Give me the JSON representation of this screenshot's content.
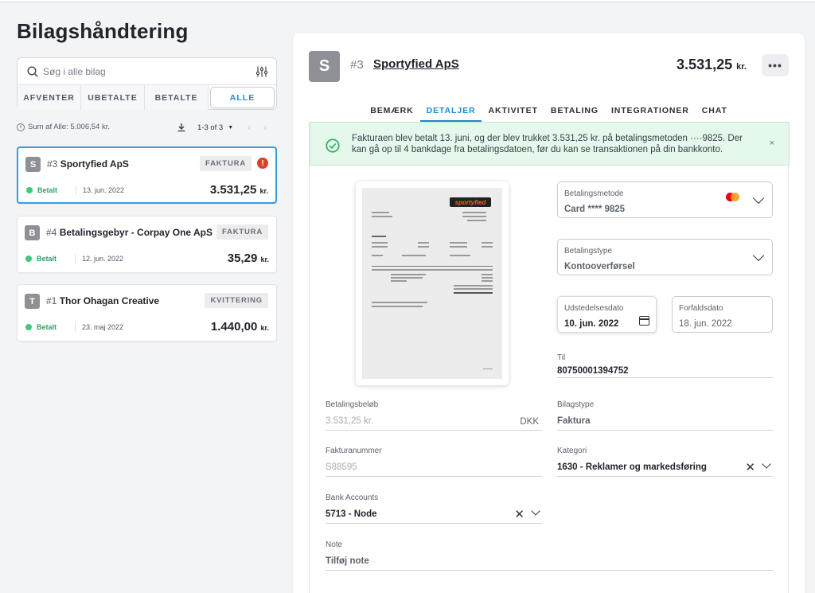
{
  "app": {
    "title": "Bilagshåndtering"
  },
  "search": {
    "placeholder": "Søg i alle bilag"
  },
  "filters": [
    "AFVENTER",
    "UBETALTE",
    "BETALTE",
    "ALLE"
  ],
  "summary": {
    "sum_text": "Sum af Alle: 5.006,54 kr.",
    "pager_text": "1-3 of 3"
  },
  "bills": [
    {
      "avatar": "S",
      "num": "#3",
      "name": "Sportyfied ApS",
      "type": "FAKTURA",
      "status": "Betalt",
      "date": "13. jun. 2022",
      "amount": "3.531,25",
      "currency": "kr.",
      "alert": "!"
    },
    {
      "avatar": "B",
      "num": "#4",
      "name": "Betalingsgebyr - Corpay One ApS",
      "type": "FAKTURA",
      "status": "Betalt",
      "date": "12. jun. 2022",
      "amount": "35,29",
      "currency": "kr."
    },
    {
      "avatar": "T",
      "num": "#1",
      "name": "Thor Ohagan Creative",
      "type": "KVITTERING",
      "status": "Betalt",
      "date": "23. maj 2022",
      "amount": "1.440,00",
      "currency": "kr."
    }
  ],
  "detail": {
    "avatar": "S",
    "num": "#3",
    "title": "Sportyfied ApS",
    "amount": "3.531,25",
    "currency": "kr.",
    "more": "•••",
    "tabs": [
      "BEMÆRK",
      "DETALJER",
      "AKTIVITET",
      "BETALING",
      "INTEGRATIONER",
      "CHAT"
    ],
    "active_tab": "DETALJER",
    "success_message": "Fakturaen blev betalt 13. juni, og der blev trukket 3.531,25 kr. på betalingsmetoden ····9825. Der kan gå op til 4 bankdage fra betalingsdatoen, før du kan se transaktionen på din bankkonto.",
    "close": "×",
    "thumb_logo": "sportyfied",
    "fields": {
      "payment_method": {
        "label": "Betalingsmetode",
        "value": "Card **** 9825"
      },
      "payment_type": {
        "label": "Betalingstype",
        "value": "Kontooverførsel"
      },
      "issue_date": {
        "label": "Udstedelsesdato",
        "value": "10. jun. 2022"
      },
      "due_date": {
        "label": "Forfaldsdato",
        "value": "18. jun. 2022"
      },
      "to": {
        "label": "Til",
        "value": "80750001394752"
      },
      "amount": {
        "label": "Betalingsbeløb",
        "value": "3.531,25 kr.",
        "currency": "DKK"
      },
      "doc_type": {
        "label": "Bilagstype",
        "value": "Faktura"
      },
      "invoice_no": {
        "label": "Fakturanummer",
        "value": "S88595"
      },
      "category": {
        "label": "Kategori",
        "value": "1630 - Reklamer og markedsføring"
      },
      "bank_accounts": {
        "label": "Bank Accounts",
        "value": "5713 - Node"
      },
      "note": {
        "label": "Note",
        "value": "Tilføj note"
      }
    }
  },
  "colors": {
    "accent": "#1e8ad6",
    "success_bg": "#e5f8ec",
    "paid_green": "#3fc97d",
    "alert_red": "#d9412a"
  }
}
